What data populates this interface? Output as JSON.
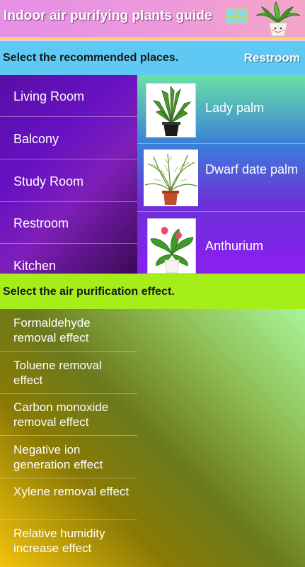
{
  "header": {
    "title": "Indoor air purifying plants guide",
    "icons": [
      "window-icon",
      "potted-plant-logo"
    ]
  },
  "places_section": {
    "label": "Select the recommended places.",
    "selected": "Restroom",
    "items": [
      "Living Room",
      "Balcony",
      "Study Room",
      "Restroom",
      "Kitchen"
    ]
  },
  "plants": [
    {
      "name": "Lady palm"
    },
    {
      "name": "Dwarf date palm"
    },
    {
      "name": "Anthurium"
    }
  ],
  "effects_section": {
    "label": "Select the air purification effect.",
    "items": [
      "Formaldehyde removal effect",
      "Toluene removal effect",
      "Carbon monoxide removal effect",
      "Negative ion generation effect",
      "Xylene removal effect",
      "Relative humidity increase effect"
    ]
  },
  "colors": {
    "header": "#e58fe7",
    "places_bar": "#5ec9f3",
    "effects_bar": "#a6ee1a",
    "places_bg": "#6611c2"
  }
}
